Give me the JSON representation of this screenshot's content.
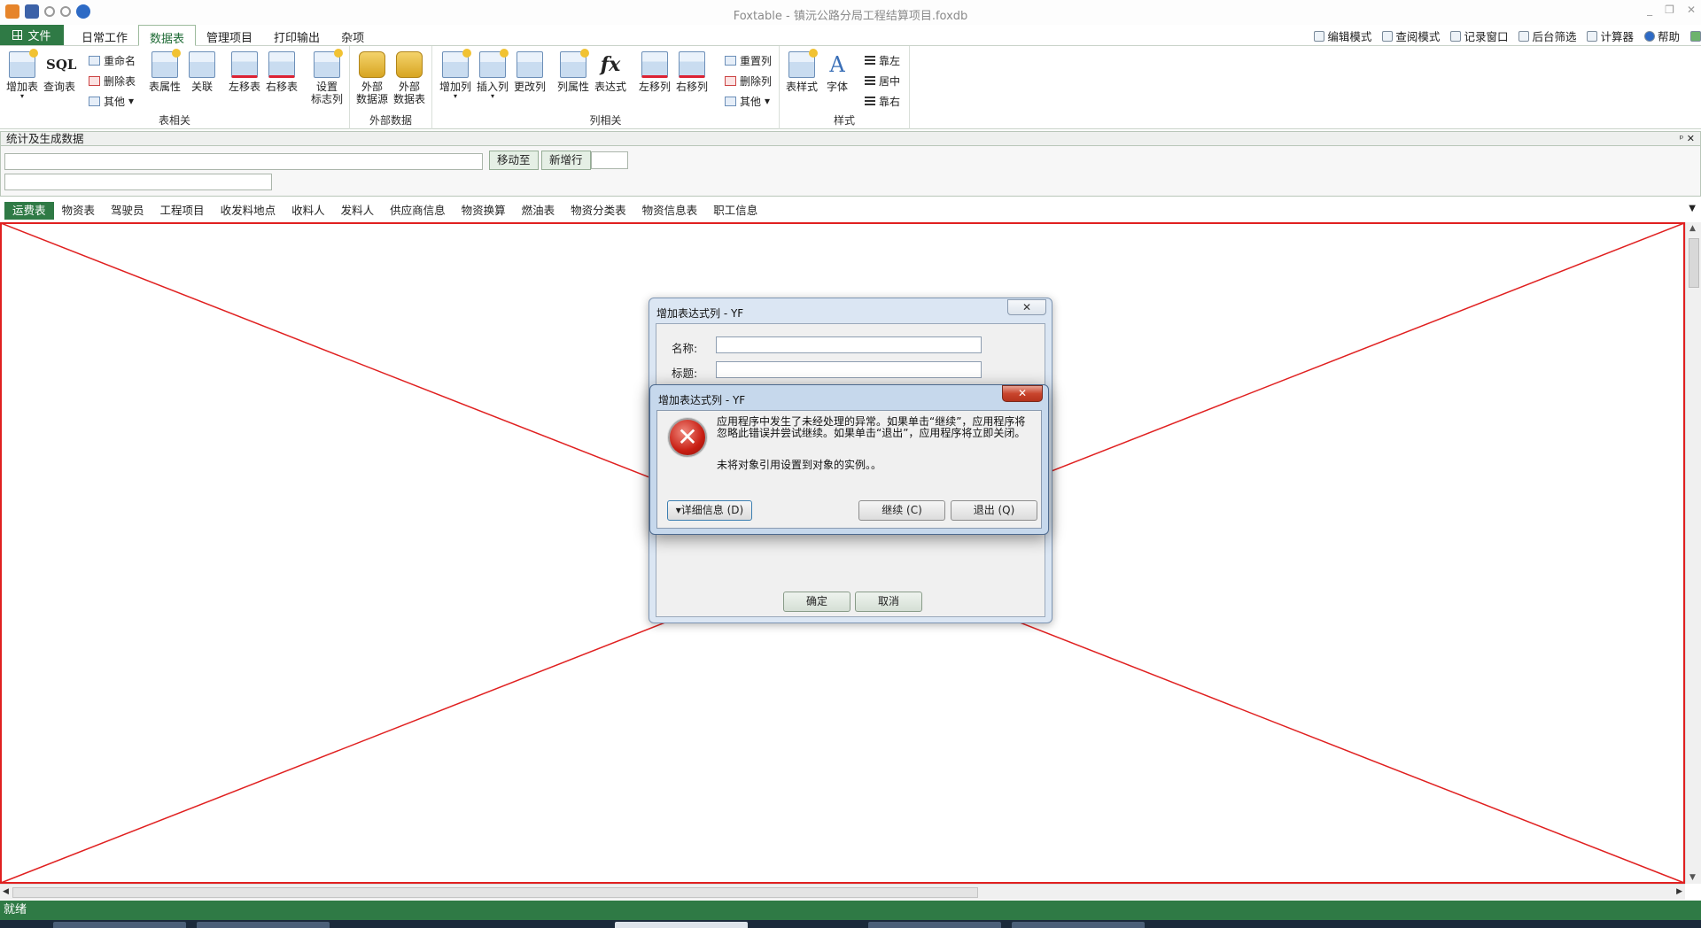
{
  "app": {
    "title": "Foxtable - 镇沅公路分局工程结算项目.foxdb",
    "minimize": "_",
    "restore": "❐",
    "close": "✕"
  },
  "menu": {
    "file_label": "文件",
    "tabs": [
      "日常工作",
      "数据表",
      "管理项目",
      "打印输出",
      "杂项"
    ],
    "active_tab": "数据表"
  },
  "right_tools": [
    "编辑模式",
    "查阅模式",
    "记录窗口",
    "后台筛选",
    "计算器",
    "帮助"
  ],
  "ribbon": {
    "groups": [
      "表相关",
      "外部数据",
      "列相关",
      "样式"
    ],
    "table": {
      "add_table": "增加表",
      "query_table": "查询表",
      "sql": "SQL",
      "rename": "重命名",
      "delete_table": "删除表",
      "other": "其他",
      "table_props": "表属性",
      "relation": "关联",
      "move_left": "左移表",
      "move_right": "右移表",
      "set_flag_col_1": "设置",
      "set_flag_col_2": "标志列"
    },
    "external": {
      "ext_source_1": "外部",
      "ext_source_2": "数据源",
      "ext_table_1": "外部",
      "ext_table_2": "数据表"
    },
    "column": {
      "add_col": "增加列",
      "insert_col": "插入列",
      "change_col": "更改列",
      "col_props": "列属性",
      "expression": "表达式",
      "fx": "fx",
      "move_left": "左移列",
      "move_right": "右移列",
      "reset_col": "重置列",
      "delete_col": "删除列",
      "other": "其他"
    },
    "style": {
      "table_style": "表样式",
      "font": "字体",
      "font_glyph": "A",
      "align_left": "靠左",
      "align_center": "居中",
      "align_right": "靠右"
    }
  },
  "stat_panel": {
    "title": "统计及生成数据",
    "pin": "ᵖ ✕",
    "move_to": "移动至",
    "new_row": "新增行"
  },
  "table_tabs": [
    "运费表",
    "物资表",
    "驾驶员",
    "工程项目",
    "收发料地点",
    "收料人",
    "发料人",
    "供应商信息",
    "物资换算",
    "燃油表",
    "物资分类表",
    "物资信息表",
    "职工信息"
  ],
  "active_table_tab": "运费表",
  "status_text": "就绪",
  "back_dialog": {
    "title": "增加表达式列 - YF",
    "close": "✕",
    "name_label": "名称:",
    "caption_label": "标题:",
    "ok": "确定",
    "cancel": "取消"
  },
  "error_dialog": {
    "title": "增加表达式列 - YF",
    "close": "✕",
    "icon": "✕",
    "message": "应用程序中发生了未经处理的异常。如果单击“继续”，应用程序将忽略此错误并尝试继续。如果单击“退出”，应用程序将立即关闭。",
    "detail": "未将对象引用设置到对象的实例。。",
    "details_button": "▾详细信息 (D)",
    "continue_button": "继续 (C)",
    "quit_button": "退出 (Q)"
  }
}
